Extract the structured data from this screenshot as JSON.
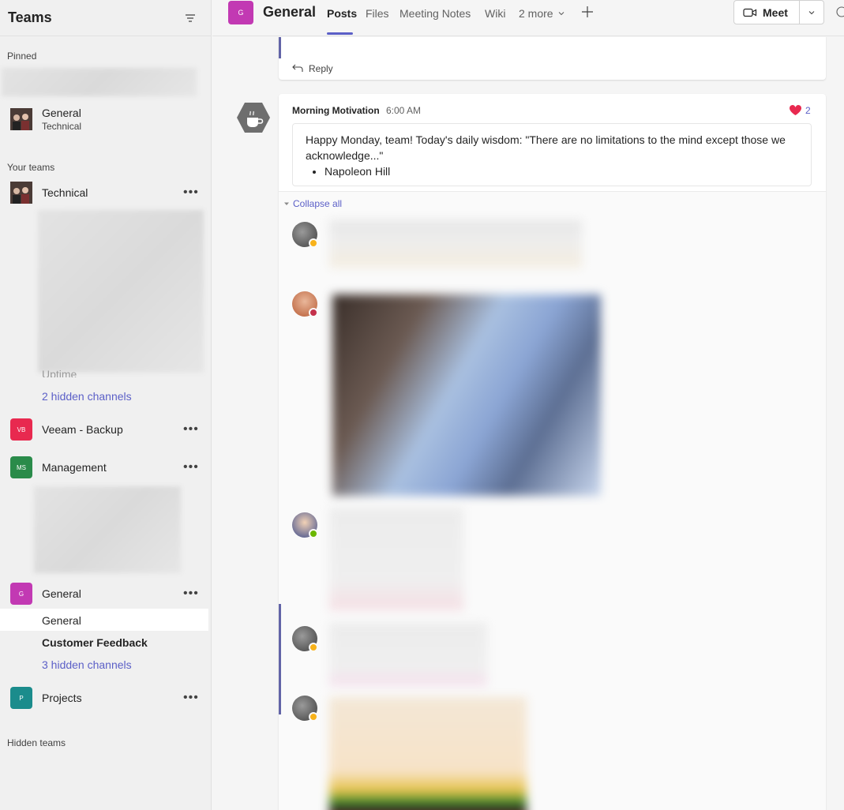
{
  "sidebar": {
    "title": "Teams",
    "pinned_label": "Pinned",
    "pinned_item": {
      "name": "General",
      "team": "Technical"
    },
    "your_teams_label": "Your teams",
    "teams": [
      {
        "name": "Technical",
        "initials": ""
      },
      {
        "name": "Veeam - Backup",
        "initials": "VB",
        "color": "#e8294f"
      },
      {
        "name": "Management",
        "initials": "MS",
        "color": "#2a8b4a"
      },
      {
        "name": "General",
        "initials": "G",
        "color": "#c239b3"
      },
      {
        "name": "Projects",
        "initials": "P",
        "color": "#1b8c8c"
      }
    ],
    "technical_channels": {
      "partial": "Uptime",
      "hidden": "2 hidden channels"
    },
    "general_channels": {
      "selected": "General",
      "bold": "Customer Feedback",
      "hidden": "3 hidden channels"
    },
    "hidden_teams_label": "Hidden teams"
  },
  "header": {
    "channel_initial": "G",
    "channel_title": "General",
    "tabs": [
      "Posts",
      "Files",
      "Meeting Notes",
      "Wiki",
      "2 more"
    ],
    "meet_label": "Meet"
  },
  "feed": {
    "reply_label": "Reply",
    "post": {
      "author": "Morning Motivation",
      "time": "6:00 AM",
      "reaction_count": "2",
      "text": "Happy Monday, team! Today's daily wisdom: \"There are no limitations to the mind except those we acknowledge...\"",
      "bullet": "Napoleon Hill"
    },
    "collapse_label": "Collapse all"
  },
  "colors": {
    "accent": "#5b5fc7",
    "heart": "#e8294f"
  }
}
